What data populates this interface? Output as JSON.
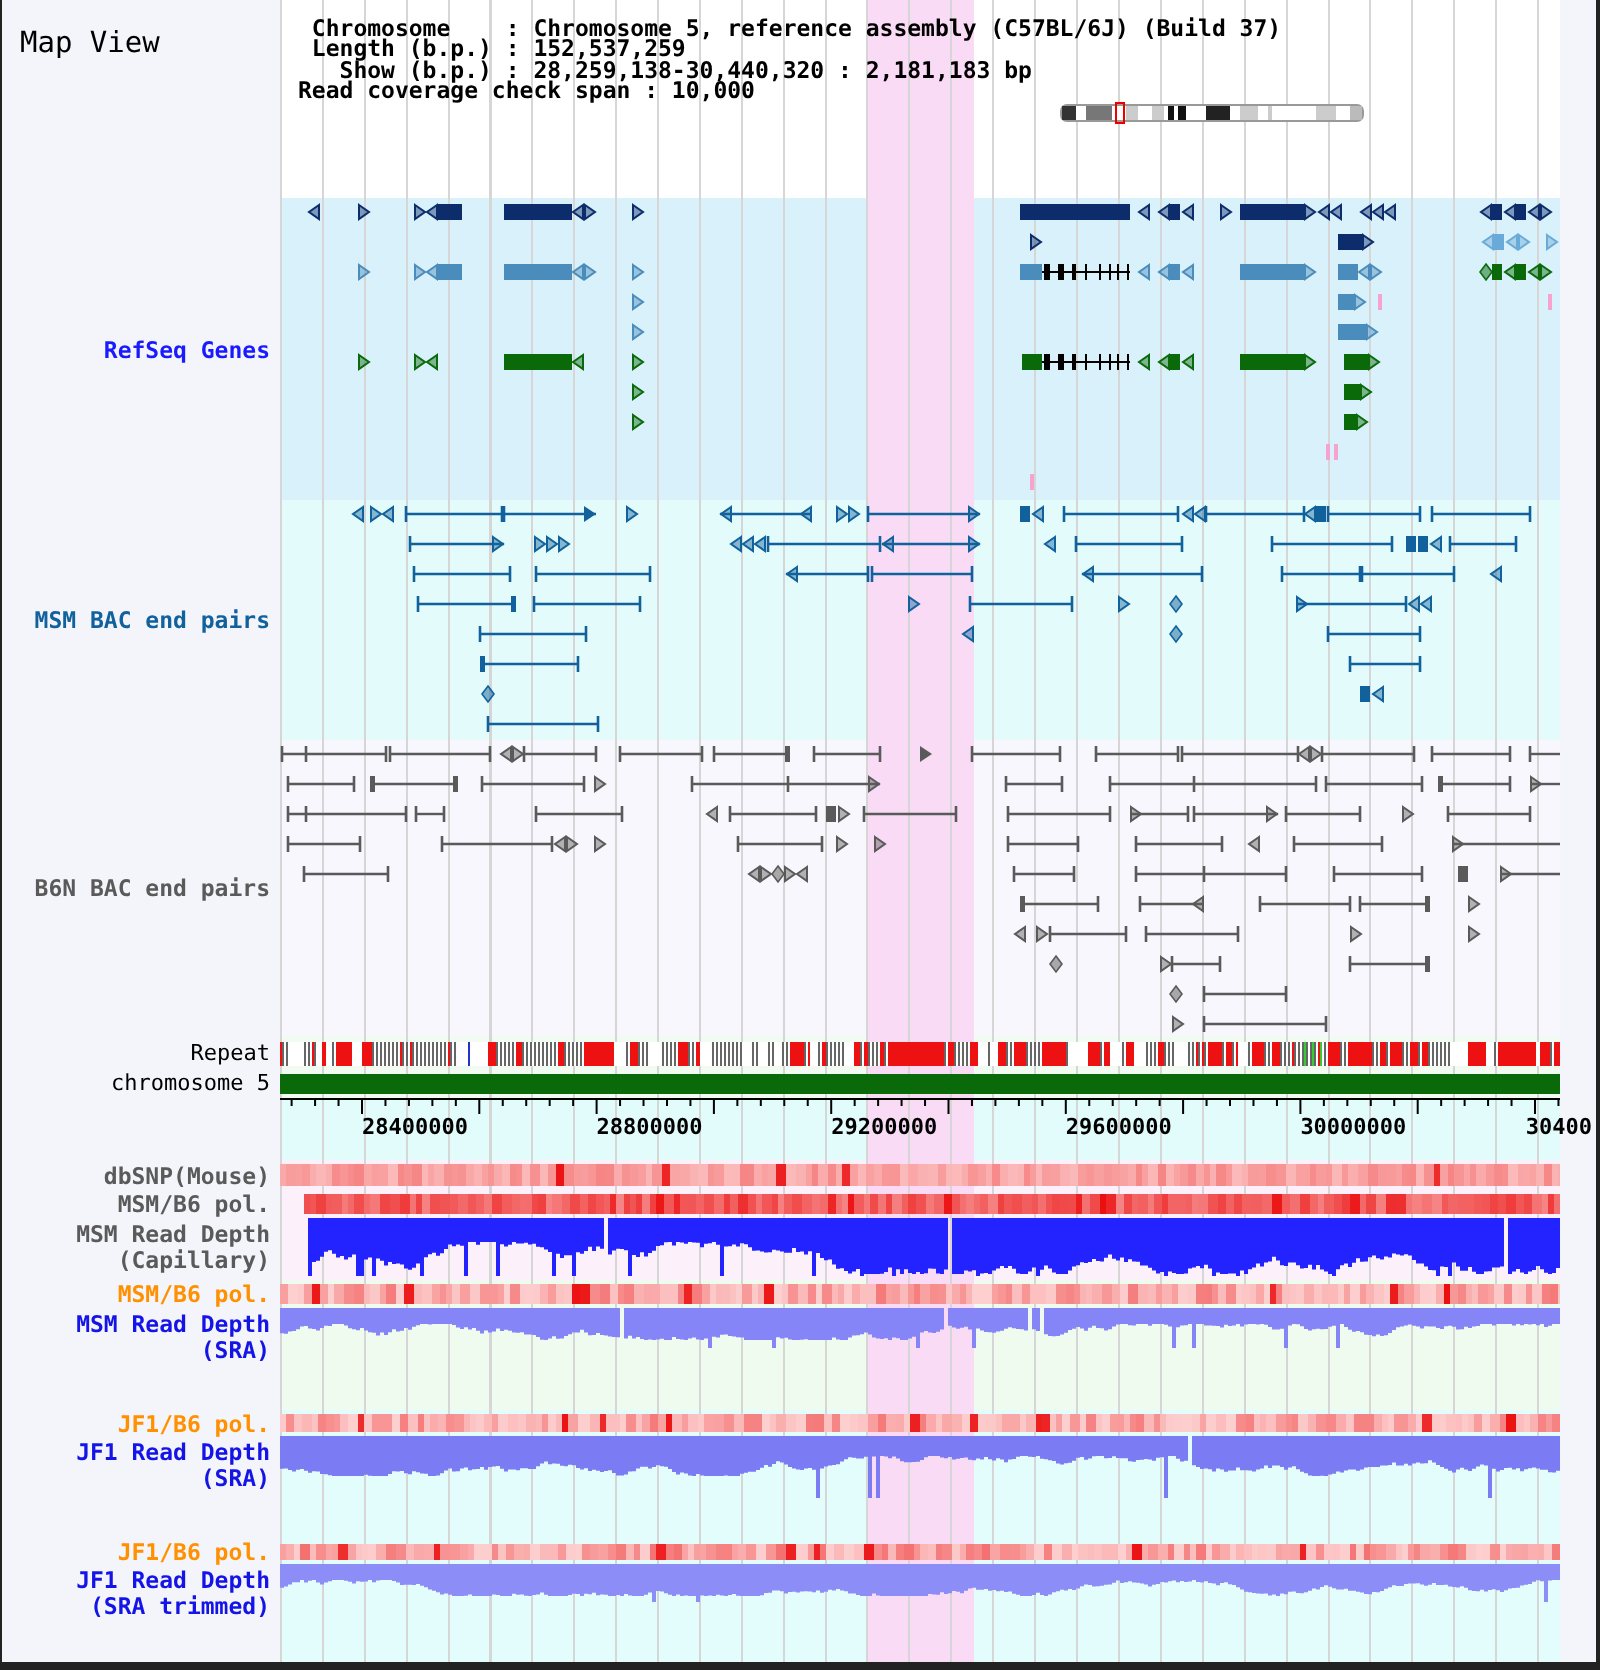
{
  "title": "Map View",
  "info_lines": [
    "Chromosome    : Chromosome 5, reference assembly (C57BL/6J) (Build 37)",
    "Length (b.p.) : 152,537,259",
    "Show (b.p.) : 28,259,138-30,440,320 : 2,181,183 bp",
    "Read coverage check span : 10,000"
  ],
  "tracks": [
    {
      "kind": "genes",
      "label": "RefSeq Genes",
      "color": "#1a1aff"
    },
    {
      "kind": "bac_pairs",
      "label": "MSM BAC end pairs",
      "color": "#11629c"
    },
    {
      "kind": "bac_pairs",
      "label": "B6N BAC end pairs",
      "color": "#5a5a5a"
    },
    {
      "kind": "repeat",
      "label": "Repeat",
      "color": "#000000"
    },
    {
      "kind": "chromosome",
      "label": "chromosome 5",
      "color": "#000000"
    },
    {
      "kind": "axis",
      "labels": [
        "28400000",
        "28800000",
        "29200000",
        "29600000",
        "30000000",
        "30400"
      ]
    },
    {
      "kind": "polymorphism",
      "label": "dbSNP(Mouse)",
      "color": "#5a5a5a"
    },
    {
      "kind": "polymorphism",
      "label": "MSM/B6 pol.",
      "color": "#5a5a5a"
    },
    {
      "kind": "depth",
      "label": "MSM Read Depth (Capillary)",
      "color": "#5a5a5a"
    },
    {
      "kind": "polymorphism",
      "label": "MSM/B6 pol.",
      "color": "#ff9000"
    },
    {
      "kind": "depth",
      "label": "MSM Read Depth (SRA)",
      "color": "#1414e6"
    },
    {
      "kind": "polymorphism",
      "label": "JF1/B6 pol.",
      "color": "#ff9000"
    },
    {
      "kind": "depth",
      "label": "JF1 Read Depth (SRA)",
      "color": "#1414e6"
    },
    {
      "kind": "polymorphism",
      "label": "JF1/B6 pol.",
      "color": "#ff9000"
    },
    {
      "kind": "depth",
      "label": "JF1 Read Depth (SRA trimmed)",
      "color": "#1414e6"
    }
  ]
}
